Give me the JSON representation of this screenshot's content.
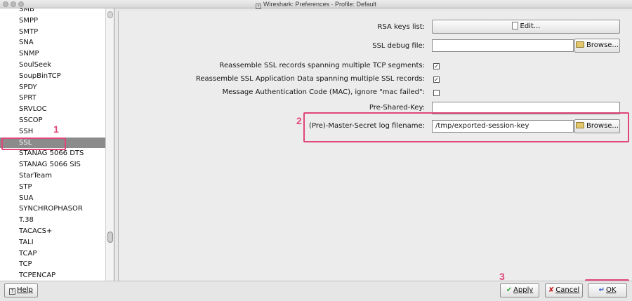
{
  "window": {
    "title": "Wireshark: Preferences · Profile: Default"
  },
  "sidebar": {
    "items": [
      "SMB",
      "SMPP",
      "SMTP",
      "SNA",
      "SNMP",
      "SoulSeek",
      "SoupBinTCP",
      "SPDY",
      "SPRT",
      "SRVLOC",
      "SSCOP",
      "SSH",
      "SSL",
      "STANAG 5066 DTS",
      "STANAG 5066 SIS",
      "StarTeam",
      "STP",
      "SUA",
      "SYNCHROPHASOR",
      "T.38",
      "TACACS+",
      "TALI",
      "TCAP",
      "TCP",
      "TCPENCAP"
    ],
    "selected": "SSL"
  },
  "ssl": {
    "rsa_keys_label": "RSA keys list:",
    "rsa_edit_button": "Edit...",
    "debug_file_label": "SSL debug file:",
    "debug_file_value": "",
    "browse_label": "Browse...",
    "reassemble_records_label": "Reassemble SSL records spanning multiple TCP segments:",
    "reassemble_records_checked": true,
    "reassemble_appdata_label": "Reassemble SSL Application Data spanning multiple SSL records:",
    "reassemble_appdata_checked": true,
    "mac_ignore_label": "Message Authentication Code (MAC), ignore \"mac failed\":",
    "mac_ignore_checked": false,
    "psk_label": "Pre-Shared-Key:",
    "psk_value": "",
    "master_secret_label": "(Pre)-Master-Secret log filename:",
    "master_secret_value": "/tmp/exported-session-key"
  },
  "annotations": {
    "marker_1": "1",
    "marker_2": "2",
    "marker_3": "3"
  },
  "footer": {
    "help_label": "Help",
    "apply_label": "Apply",
    "cancel_label": "Cancel",
    "ok_label": "OK"
  },
  "colors": {
    "highlight": "#e0457b",
    "selection": "#8b8b8b"
  }
}
